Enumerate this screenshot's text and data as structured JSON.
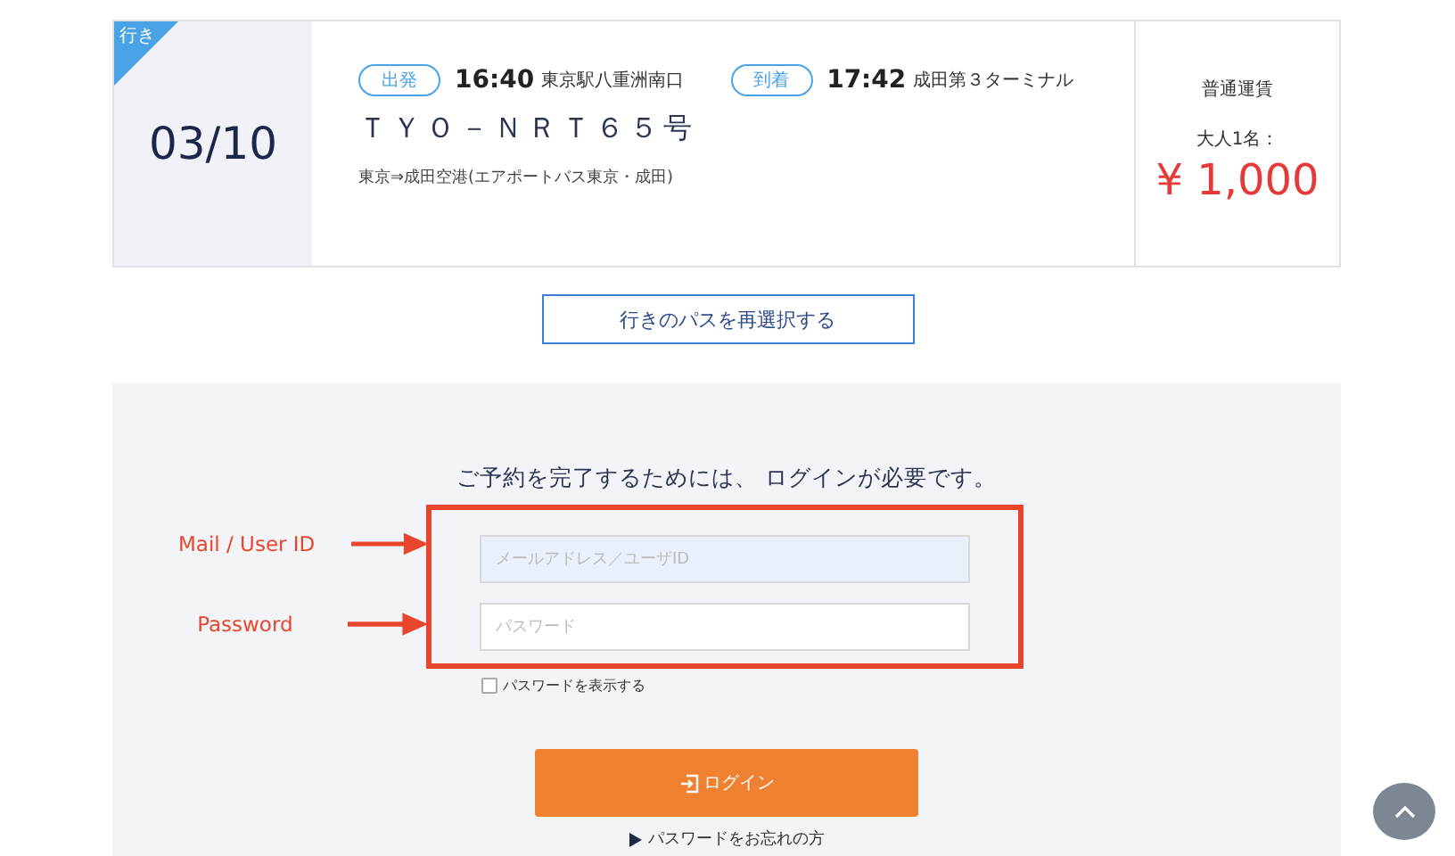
{
  "trip": {
    "direction": "行き",
    "date": "03/10",
    "departure": {
      "badge": "出発",
      "time": "16:40",
      "place": "東京駅八重洲南口"
    },
    "arrival": {
      "badge": "到着",
      "time": "17:42",
      "place": "成田第３ターミナル"
    },
    "bus_name": "ＴＹＯ－ＮＲＴ６５号",
    "route": "東京⇒成田空港(エアポートバス東京・成田)",
    "fare_type": "普通運賃",
    "passengers": "大人1名：",
    "price": "¥ 1,000"
  },
  "reselect_button": "行きのパスを再選択する",
  "login": {
    "heading": "ご予約を完了するためには、 ログインが必要です。",
    "fields": [
      {
        "placeholder": "メールアドレス／ユーザID",
        "highlighted": true
      },
      {
        "placeholder": "パスワード",
        "highlighted": false
      }
    ],
    "show_password": {
      "label": "パスワードを表示する",
      "checked": false
    },
    "button": "ログイン",
    "forgot": "パスワードをお忘れの方"
  },
  "annotations": [
    "Mail / User ID",
    "Password"
  ]
}
